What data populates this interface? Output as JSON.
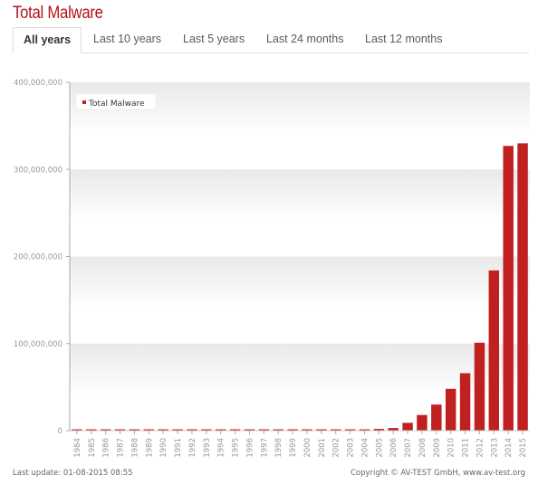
{
  "title": "Total Malware",
  "tabs": [
    {
      "label": "All years",
      "active": true
    },
    {
      "label": "Last 10 years",
      "active": false
    },
    {
      "label": "Last 5 years",
      "active": false
    },
    {
      "label": "Last 24 months",
      "active": false
    },
    {
      "label": "Last 12 months",
      "active": false
    }
  ],
  "footer": {
    "last_update": "Last update: 01-08-2015 08:55",
    "copyright": "Copyright © AV-TEST GmbH, www.av-test.org"
  },
  "colors": {
    "accent": "#b5121b",
    "bar": "#c0201f",
    "axis_text": "#999999"
  },
  "chart_data": {
    "type": "bar",
    "title": "Total Malware",
    "xlabel": "",
    "ylabel": "",
    "ylim": [
      0,
      400000000
    ],
    "yticks": [
      0,
      100000000,
      200000000,
      300000000,
      400000000
    ],
    "ytick_labels": [
      "0",
      "100,000,000",
      "200,000,000",
      "300,000,000",
      "400,000,000"
    ],
    "legend": {
      "entries": [
        "Total Malware"
      ],
      "position": "top-left"
    },
    "grid": true,
    "categories": [
      "1984",
      "1985",
      "1986",
      "1987",
      "1988",
      "1989",
      "1990",
      "1991",
      "1992",
      "1993",
      "1994",
      "1995",
      "1996",
      "1997",
      "1998",
      "1999",
      "2000",
      "2001",
      "2002",
      "2003",
      "2004",
      "2005",
      "2006",
      "2007",
      "2008",
      "2009",
      "2010",
      "2011",
      "2012",
      "2013",
      "2014",
      "2015"
    ],
    "series": [
      {
        "name": "Total Malware",
        "values": [
          1000,
          2000,
          3000,
          5000,
          8000,
          12000,
          20000,
          30000,
          50000,
          80000,
          120000,
          180000,
          250000,
          350000,
          500000,
          700000,
          900000,
          1000000,
          1100000,
          1200000,
          1400000,
          2000000,
          3000000,
          9000000,
          18000000,
          30000000,
          48000000,
          66000000,
          101000000,
          184000000,
          327000000,
          330000000
        ]
      }
    ]
  }
}
